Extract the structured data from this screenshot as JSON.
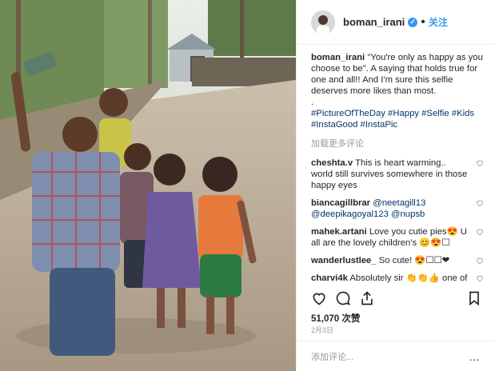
{
  "post": {
    "username": "boman_irani",
    "follow_label": "关注",
    "dot": "•",
    "caption_user": "boman_irani",
    "caption_text": "\"You're only as happy as you choose to be\". A saying that holds true for one and all!! And I'm sure this selfie deserves more likes than most.",
    "caption_dot": ".",
    "hashtags": "#PictureOfTheDay #Happy #Selfie #Kids #InstaGood #InstaPic",
    "load_more": "加载更多评论",
    "comments": [
      {
        "user": "cheshta.v",
        "text": "This is heart warming.. world still survives somewhere in those happy eyes"
      },
      {
        "user": "biancagillbrar",
        "text": "@neetagill13 @deepikagoyal123 @nupsb"
      },
      {
        "user": "mahek.artani",
        "text": "Love you cutie pies😍 U all are the lovely children's 😊😍☐"
      },
      {
        "user": "wanderlustlee_",
        "text": "So cute! 😍☐☐❤"
      },
      {
        "user": "charvi4k",
        "text": "Absolutely sir 👏👏👍 one of d Bestest ever made Happyyyyy"
      }
    ],
    "likes": "51,070 次赞",
    "date": "2月3日",
    "add_comment_placeholder": "添加评论...",
    "more_icon": "…"
  },
  "colors": {
    "accent": "#3897f0",
    "hashtag": "#003569"
  },
  "icons": [
    "heart-icon",
    "comment-icon",
    "share-icon",
    "bookmark-icon",
    "verified-icon"
  ]
}
